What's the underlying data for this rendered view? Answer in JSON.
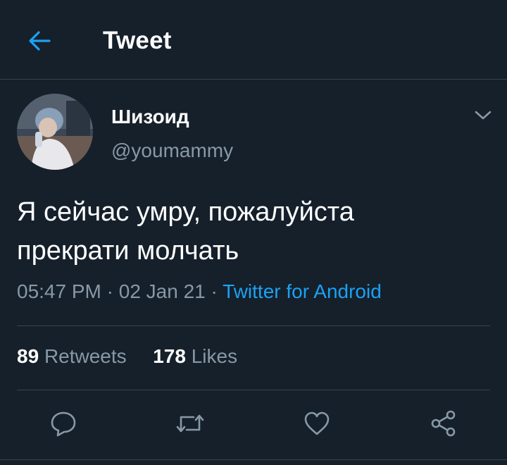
{
  "header": {
    "title": "Tweet",
    "back_icon": "arrow-left-icon"
  },
  "colors": {
    "background": "#15202b",
    "accent": "#1da1f2",
    "secondary_text": "#8899a6",
    "divider": "#38444d"
  },
  "tweet": {
    "display_name": "Шизоид",
    "handle": "@youmammy",
    "text": "Я сейчас умру, пожалуйста\nпрекрати молчать",
    "time": "05:47 PM",
    "date": "02 Jan 21",
    "source": "Twitter for Android",
    "avatar_icon": "avatar-photo",
    "menu_icon": "chevron-down-icon"
  },
  "stats": {
    "retweets_count": "89",
    "retweets_label": "Retweets",
    "likes_count": "178",
    "likes_label": "Likes"
  },
  "actions": {
    "reply_icon": "reply-icon",
    "retweet_icon": "retweet-icon",
    "like_icon": "heart-icon",
    "share_icon": "share-icon"
  }
}
